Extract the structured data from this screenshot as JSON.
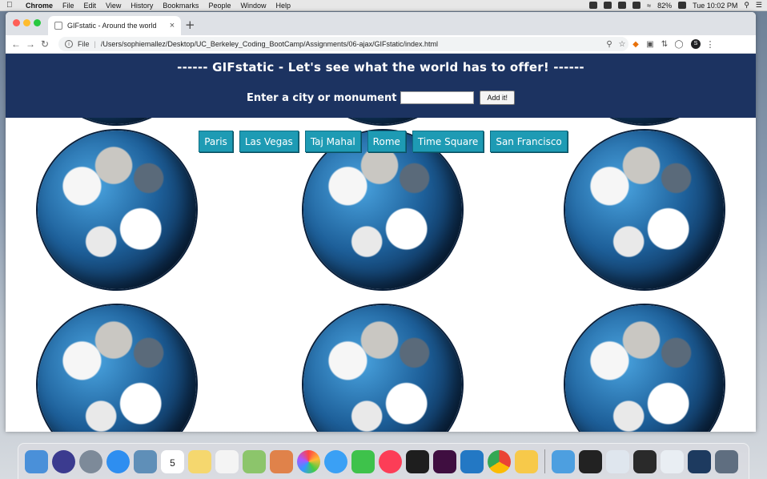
{
  "menubar": {
    "app_name": "Chrome",
    "items": [
      "File",
      "Edit",
      "View",
      "History",
      "Bookmarks",
      "People",
      "Window",
      "Help"
    ],
    "battery": "82%",
    "clock": "Tue 10:02 PM"
  },
  "browser": {
    "tab_title": "GIFstatic - Around the world",
    "new_tab_symbol": "+",
    "scheme_label": "File",
    "url": "/Users/sophiemallez/Desktop/UC_Berkeley_Coding_BootCamp/Assignments/06-ajax/GIFstatic/index.html",
    "profile_initial": "S"
  },
  "page": {
    "title": "------ GIFstatic - Let's see what the world has to offer! ------",
    "search_label": "Enter a city or monument",
    "search_value": "",
    "add_button_label": "Add it!",
    "city_buttons": [
      "Paris",
      "Las Vegas",
      "Taj Mahal",
      "Rome",
      "Time Square",
      "San Francisco"
    ]
  },
  "dock": {
    "icons": [
      "finder-icon",
      "siri-icon",
      "launchpad-icon",
      "safari-icon",
      "preview-icon",
      "calendar-icon",
      "notes-icon",
      "reminders-icon",
      "maps-icon",
      "books-icon",
      "photos-icon",
      "messages-icon",
      "facetime-icon",
      "music-icon",
      "terminal-icon",
      "slack-icon",
      "vscode-icon",
      "chrome-icon",
      "sketch-icon",
      "downloads-icon",
      "screenshot-icon",
      "window-thumb-icon",
      "window-thumb-icon",
      "window-thumb-icon",
      "window-thumb-icon",
      "window-thumb-icon",
      "trash-icon"
    ],
    "calendar_day": "5"
  },
  "colors": {
    "header_bg": "#1c3361",
    "city_button_bg": "#1e9bb4"
  }
}
